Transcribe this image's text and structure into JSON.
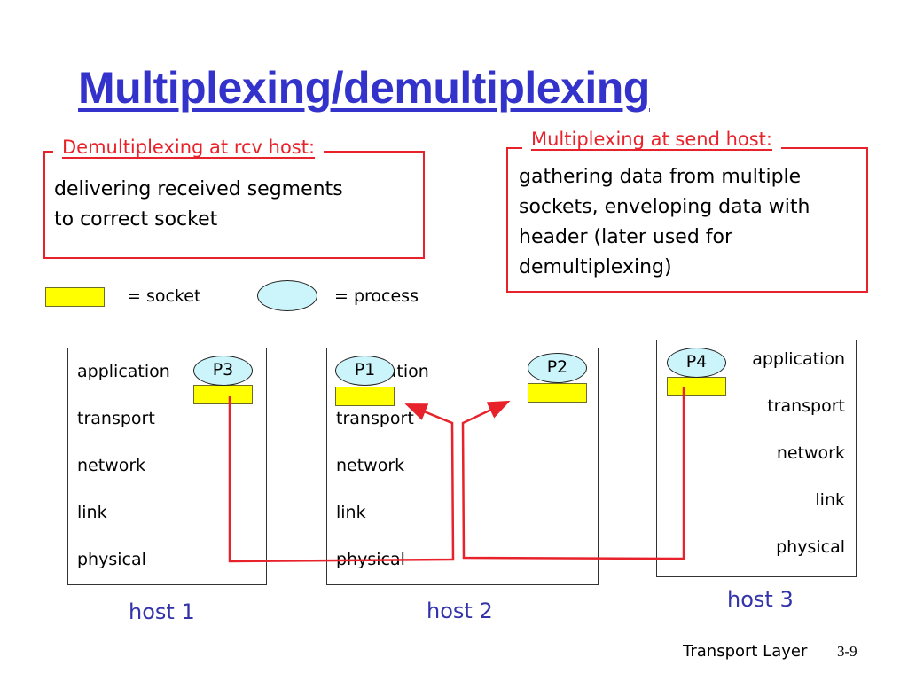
{
  "title": "Multiplexing/demultiplexing",
  "callouts": {
    "demux": {
      "label": "Demultiplexing at rcv host:",
      "body": "delivering received segments\nto correct socket"
    },
    "mux": {
      "label": "Multiplexing at send host:",
      "body": "gathering data from multiple\nsockets, enveloping data with\nheader (later used for\ndemultiplexing)"
    }
  },
  "legend": {
    "socket_label": "= socket",
    "process_label": "= process"
  },
  "hosts": [
    {
      "name": "host 1",
      "layers": [
        "application",
        "transport",
        "network",
        "link",
        "physical"
      ],
      "processes": [
        "P3"
      ]
    },
    {
      "name": "host 2",
      "layers": [
        "application",
        "transport",
        "network",
        "link",
        "physical"
      ],
      "processes": [
        "P1",
        "P2"
      ]
    },
    {
      "name": "host 3",
      "layers": [
        "application",
        "transport",
        "network",
        "link",
        "physical"
      ],
      "processes": [
        "P4"
      ]
    }
  ],
  "colors": {
    "title": "#3333cc",
    "callout": "#e8222a",
    "socket": "#ffff00",
    "process": "#ccf5fb",
    "wire": "#e8222a",
    "host_label": "#3333aa"
  },
  "footer": {
    "section": "Transport Layer",
    "page": "3-9"
  }
}
